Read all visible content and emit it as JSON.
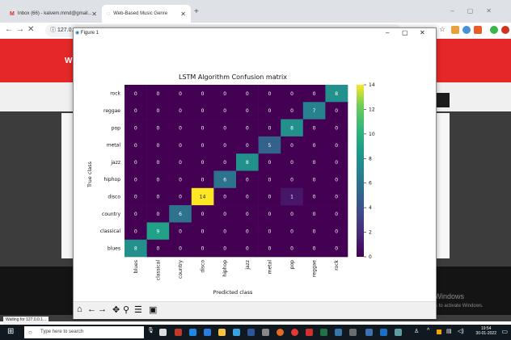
{
  "browser": {
    "tabs": [
      {
        "label": "Inbox (66) - kalvem.mmd@gmail...",
        "icon": "gmail-icon"
      },
      {
        "label": "Web-Based Music Genre",
        "icon": "loading-icon"
      }
    ],
    "address": "127.0.",
    "status_text": "Waiting for 127.0.0.1..."
  },
  "page": {
    "watermark_line1": "Activate Windows",
    "watermark_line2": "Go to Settings to activate Windows."
  },
  "figure": {
    "window_title": "Figure 1",
    "toolbar_icons": [
      "home-icon",
      "back-icon",
      "forward-icon",
      "pan-icon",
      "zoom-icon",
      "configure-subplots-icon",
      "save-icon"
    ]
  },
  "taskbar": {
    "search_placeholder": "Type here to search",
    "time": "19:54",
    "date": "30-01-2022"
  },
  "chart_data": {
    "type": "heatmap",
    "title": "LSTM Algorithm Confusion matrix",
    "xlabel": "Predicted class",
    "ylabel": "True class",
    "x_categories": [
      "blues",
      "classical",
      "country",
      "disco",
      "hiphop",
      "jazz",
      "metal",
      "pop",
      "reggae",
      "rock"
    ],
    "y_categories": [
      "rock",
      "reggae",
      "pop",
      "metal",
      "jazz",
      "hiphop",
      "disco",
      "country",
      "classical",
      "blues"
    ],
    "values": [
      [
        0,
        0,
        0,
        0,
        0,
        0,
        0,
        0,
        0,
        8
      ],
      [
        0,
        0,
        0,
        0,
        0,
        0,
        0,
        0,
        7,
        0
      ],
      [
        0,
        0,
        0,
        0,
        0,
        0,
        0,
        8,
        0,
        0
      ],
      [
        0,
        0,
        0,
        0,
        0,
        0,
        5,
        0,
        0,
        0
      ],
      [
        0,
        0,
        0,
        0,
        0,
        8,
        0,
        0,
        0,
        0
      ],
      [
        0,
        0,
        0,
        0,
        6,
        0,
        0,
        0,
        0,
        0
      ],
      [
        0,
        0,
        0,
        14,
        0,
        0,
        0,
        1,
        0,
        0
      ],
      [
        0,
        0,
        6,
        0,
        0,
        0,
        0,
        0,
        0,
        0
      ],
      [
        0,
        9,
        0,
        0,
        0,
        0,
        0,
        0,
        0,
        0
      ],
      [
        8,
        0,
        0,
        0,
        0,
        0,
        0,
        0,
        0,
        0
      ]
    ],
    "colorbar": {
      "min": 0,
      "max": 14,
      "ticks": [
        0,
        2,
        4,
        6,
        8,
        10,
        12,
        14
      ],
      "colormap": "viridis"
    }
  }
}
